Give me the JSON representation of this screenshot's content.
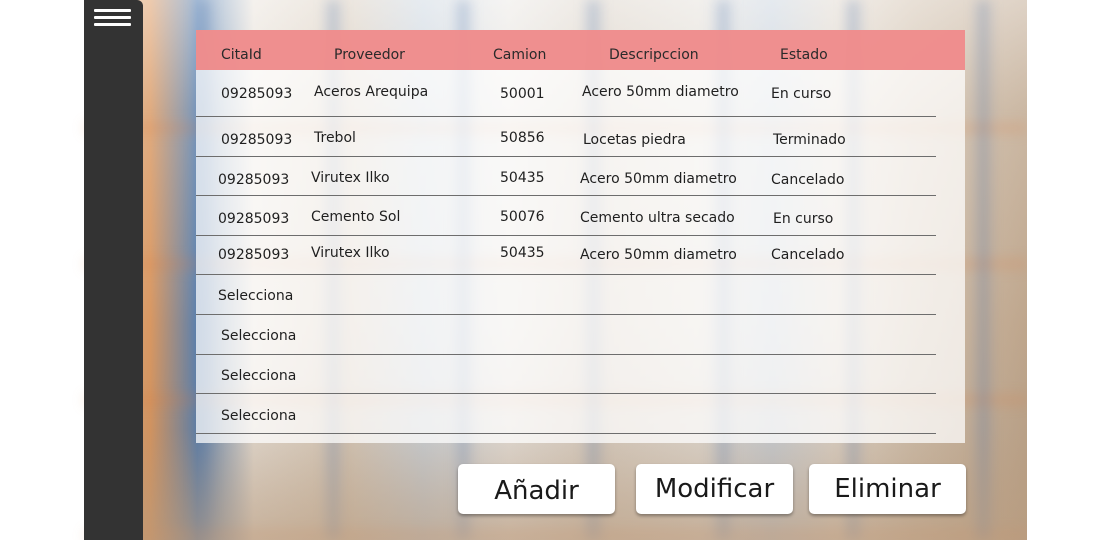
{
  "sidebar": {
    "menu_icon": "hamburger-menu-icon"
  },
  "table": {
    "headers": [
      "CitaId",
      "Proveedor",
      "Camion",
      "Descripccion",
      "Estado"
    ],
    "rows": [
      {
        "cita": "09285093",
        "proveedor": "Aceros Arequipa",
        "camion": "50001",
        "descripcion": "Acero 50mm diametro",
        "estado": "En curso"
      },
      {
        "cita": "09285093",
        "proveedor": "Trebol",
        "camion": "50856",
        "descripcion": "Locetas piedra",
        "estado": "Terminado"
      },
      {
        "cita": "09285093",
        "proveedor": "Virutex Ilko",
        "camion": "50435",
        "descripcion": "Acero 50mm diametro",
        "estado": "Cancelado"
      },
      {
        "cita": "09285093",
        "proveedor": "Cemento Sol",
        "camion": "50076",
        "descripcion": "Cemento ultra secado",
        "estado": "En curso"
      },
      {
        "cita": "09285093",
        "proveedor": "Virutex Ilko",
        "camion": "50435",
        "descripcion": "Acero 50mm diametro",
        "estado": "Cancelado"
      }
    ],
    "placeholders": [
      "Selecciona",
      "Selecciona",
      "Selecciona",
      "Selecciona"
    ]
  },
  "actions": {
    "add": "Añadir",
    "modify": "Modificar",
    "delete": "Eliminar"
  },
  "colors": {
    "header": "#ee8585",
    "sidebar": "#333333"
  }
}
